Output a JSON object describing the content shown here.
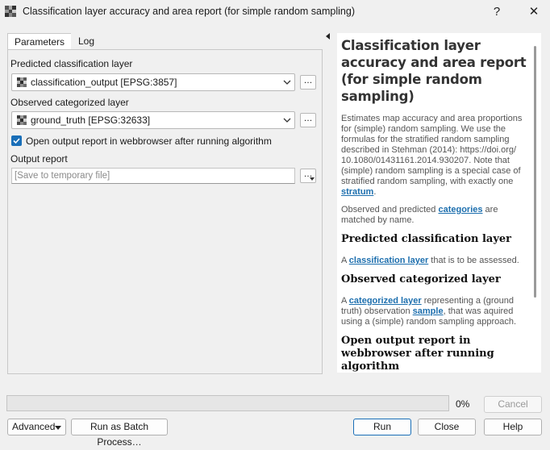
{
  "window": {
    "title": "Classification layer accuracy and area report (for simple random sampling)",
    "help_glyph": "?",
    "close_glyph": "✕"
  },
  "tabs": [
    {
      "label": "Parameters",
      "active": true
    },
    {
      "label": "Log",
      "active": false
    }
  ],
  "form": {
    "predicted_label": "Predicted classification layer",
    "predicted_value": "classification_output [EPSG:3857]",
    "observed_label": "Observed categorized layer",
    "observed_value": "ground_truth [EPSG:32633]",
    "browse_label": "…",
    "open_report_label": "Open output report in webbrowser after running algorithm",
    "open_report_checked": true,
    "output_label": "Output report",
    "output_placeholder": "[Save to temporary file]"
  },
  "help": {
    "title": "Classification layer accuracy and area report (for simple random sampling)",
    "intro_1": "Estimates map accuracy and area proportions for (simple) random sampling. We use the formulas for the stratified random sampling described in Stehman (2014): https://doi.org/ 10.1080/01431161.2014.930207. Note that (simple) random sampling is a special case of stratified random sampling, with exactly one ",
    "intro_link": "stratum",
    "intro_2": ".",
    "match_1": "Observed and predicted ",
    "match_link": "categories",
    "match_2": " are matched by name.",
    "pred_heading": "Predicted classification layer",
    "pred_1": "A ",
    "pred_link": "classification layer",
    "pred_2": " that is to be assessed.",
    "obs_heading": "Observed categorized layer",
    "obs_1": "A ",
    "obs_link": "categorized layer",
    "obs_2": " representing a (ground truth) observation ",
    "obs_link2": "sample",
    "obs_3": ", that was aquired using a (simple) random sampling approach.",
    "open_heading": "Open output report in webbrowser after running algorithm"
  },
  "progress": {
    "value": 0,
    "label": "0%"
  },
  "buttons": {
    "cancel": "Cancel",
    "advanced": "Advanced",
    "batch": "Run as Batch Process…",
    "run": "Run",
    "close": "Close",
    "help": "Help"
  },
  "colors": {
    "accent": "#1a6fb8",
    "link": "#1d6fae"
  }
}
